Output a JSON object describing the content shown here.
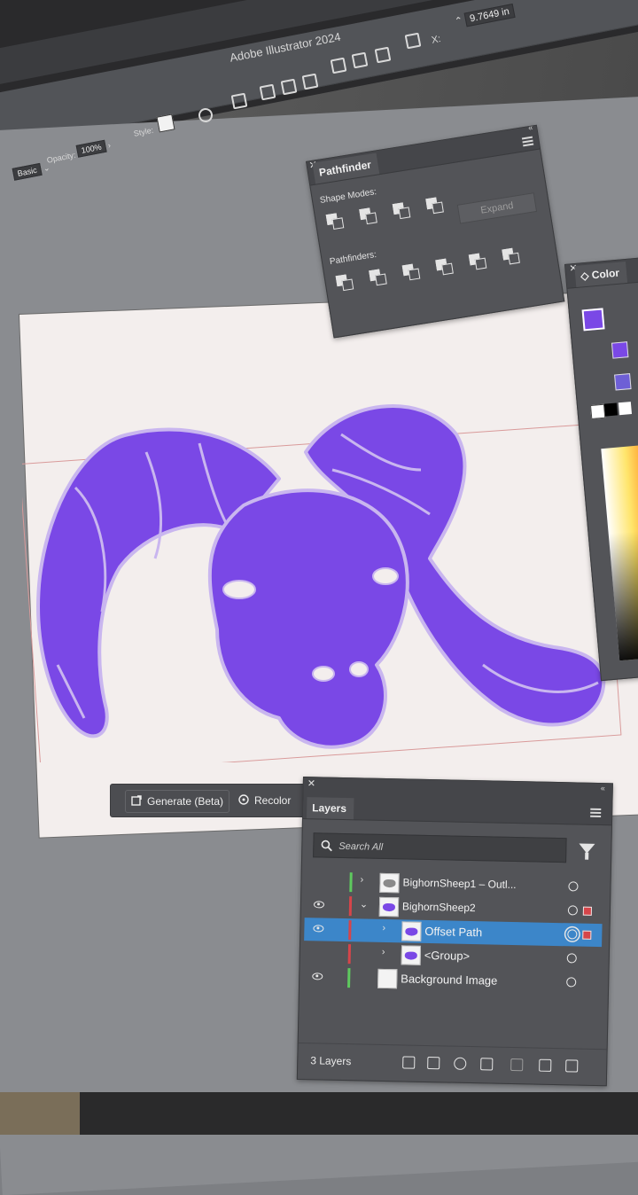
{
  "app": {
    "title": "Adobe Illustrator 2024"
  },
  "control_bar": {
    "stroke_style": "Basic",
    "opacity_label": "Opacity:",
    "opacity_value": "100%",
    "style_label": "Style:",
    "x_label": "X:",
    "x_value": "9.7649 in"
  },
  "pathfinder": {
    "tab": "Pathfinder",
    "shape_modes_label": "Shape Modes:",
    "pathfinders_label": "Pathfinders:",
    "expand_label": "Expand"
  },
  "color_panel": {
    "tab": "Color"
  },
  "contextual_bar": {
    "generate_label": "Generate (Beta)",
    "recolor_label": "Recolor"
  },
  "layers": {
    "tab": "Layers",
    "search_placeholder": "Search All",
    "rows": [
      {
        "name": "BighornSheep1 – Outl...",
        "visible": false,
        "expanded": false,
        "color": "#5ec95e"
      },
      {
        "name": "BighornSheep2",
        "visible": true,
        "expanded": true,
        "color": "#d6454a"
      },
      {
        "name": "Offset Path",
        "visible": true,
        "selected": true,
        "color": "#d6454a"
      },
      {
        "name": "<Group>",
        "visible": false,
        "color": "#d6454a"
      },
      {
        "name": "Background Image",
        "visible": true,
        "color": "#5ec95e"
      }
    ],
    "count_label": "3 Layers"
  },
  "colors": {
    "art_fill": "#7a48e6",
    "art_stroke": "#c9b6ef",
    "selection": "#3c86c9"
  }
}
